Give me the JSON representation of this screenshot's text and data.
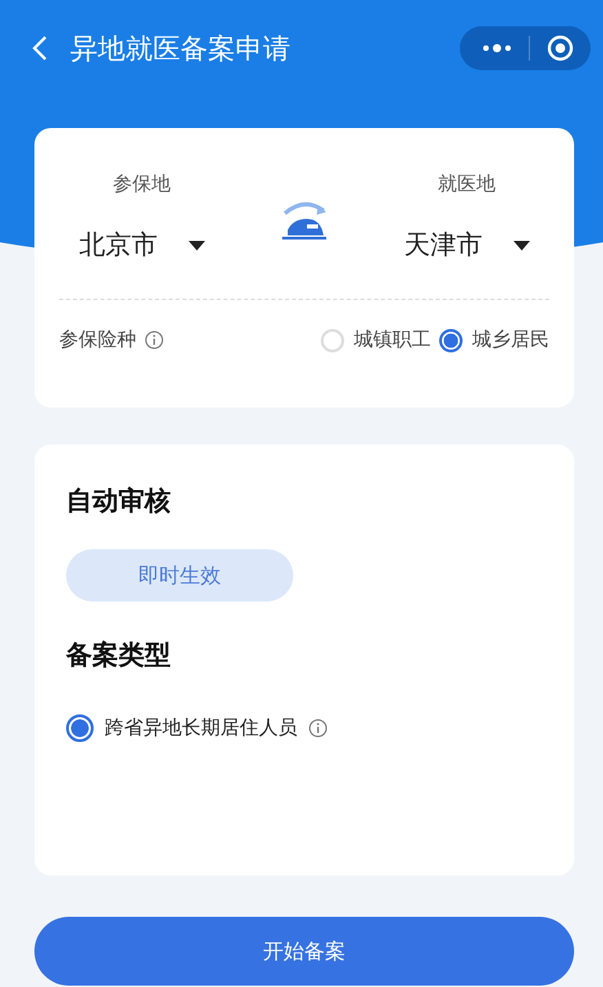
{
  "header": {
    "title": "异地就医备案申请"
  },
  "route": {
    "from": {
      "label": "参保地",
      "city": "北京市"
    },
    "to": {
      "label": "就医地",
      "city": "天津市"
    }
  },
  "insurance": {
    "label": "参保险种",
    "options": [
      {
        "label": "城镇职工",
        "selected": false
      },
      {
        "label": "城乡居民",
        "selected": true
      }
    ]
  },
  "review": {
    "title": "自动审核",
    "tag": "即时生效"
  },
  "filing": {
    "title": "备案类型",
    "options": [
      {
        "label": "跨省异地长期居住人员",
        "selected": true
      }
    ]
  },
  "submit": "开始备案"
}
